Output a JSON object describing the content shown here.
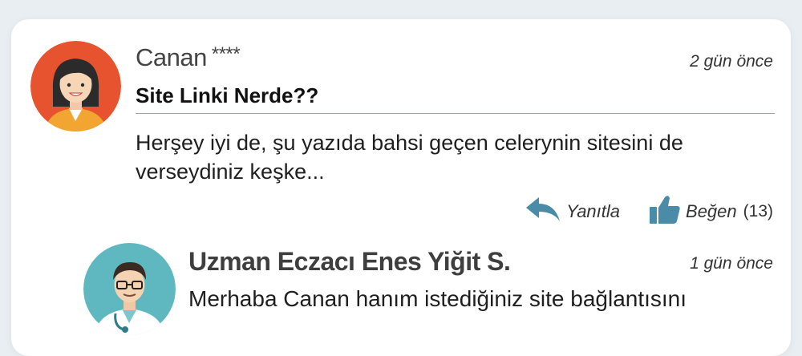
{
  "comment": {
    "author": "Canan",
    "stars": "****",
    "time": "2 gün önce",
    "subject": "Site Linki Nerde??",
    "body": "Herşey iyi de, şu yazıda bahsi geçen celerynin sitesini de verseydiniz keşke...",
    "reply_label": "Yanıtla",
    "like_label": "Beğen",
    "like_count": "(13)"
  },
  "reply": {
    "author": "Uzman Eczacı Enes Yiğit S.",
    "time": "1 gün önce",
    "body": "Merhaba Canan hanım istediğiniz site bağlantısını"
  },
  "colors": {
    "avatar_canan_bg": "#e8532f",
    "avatar_enes_bg": "#5fb7c0",
    "action_icon": "#4a8ca8"
  },
  "icons": {
    "reply": "reply-arrow-icon",
    "like": "thumbs-up-icon"
  }
}
